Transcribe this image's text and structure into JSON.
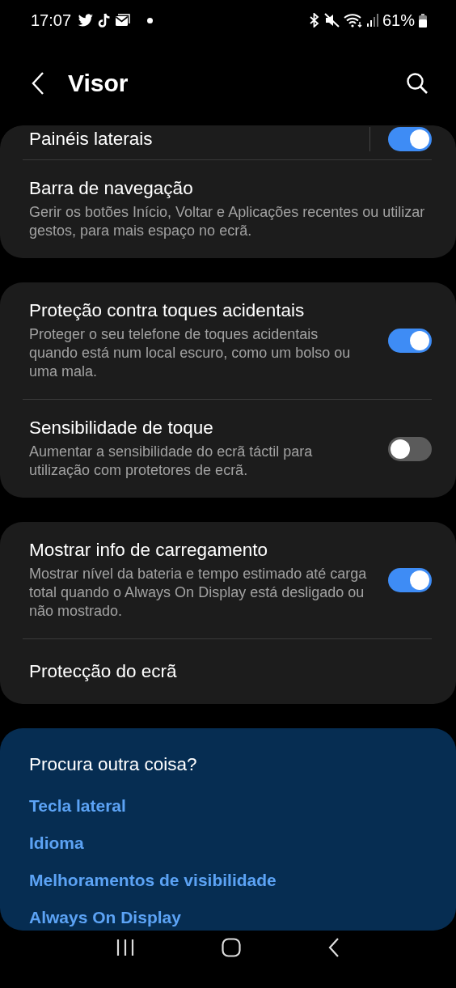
{
  "status_bar": {
    "time": "17:07",
    "battery": "61%"
  },
  "header": {
    "title": "Visor"
  },
  "groups": [
    {
      "items": [
        {
          "kind": "switch",
          "title": "Painéis laterais",
          "on": true,
          "divider": true
        },
        {
          "kind": "link",
          "title": "Barra de navegação",
          "subtitle": "Gerir os botões Início, Voltar e Aplicações recentes ou utilizar gestos, para mais espaço no ecrã."
        }
      ]
    },
    {
      "items": [
        {
          "kind": "switch",
          "title": "Proteção contra toques acidentais",
          "subtitle": "Proteger o seu telefone de toques acidentais quando está num local escuro, como um bolso ou uma mala.",
          "on": true
        },
        {
          "kind": "switch",
          "title": "Sensibilidade de toque",
          "subtitle": "Aumentar a sensibilidade do ecrã táctil para utilização com protetores de ecrã.",
          "on": false
        }
      ]
    },
    {
      "items": [
        {
          "kind": "switch",
          "title": "Mostrar info de carregamento",
          "subtitle": "Mostrar nível da bateria e tempo estimado até carga total quando o Always On Display está desligado ou não mostrado.",
          "on": true
        },
        {
          "kind": "link",
          "title": "Protecção do ecrã"
        }
      ]
    }
  ],
  "suggestions": {
    "title": "Procura outra coisa?",
    "links": [
      "Tecla lateral",
      "Idioma",
      "Melhoramentos de visibilidade",
      "Always On Display"
    ]
  }
}
